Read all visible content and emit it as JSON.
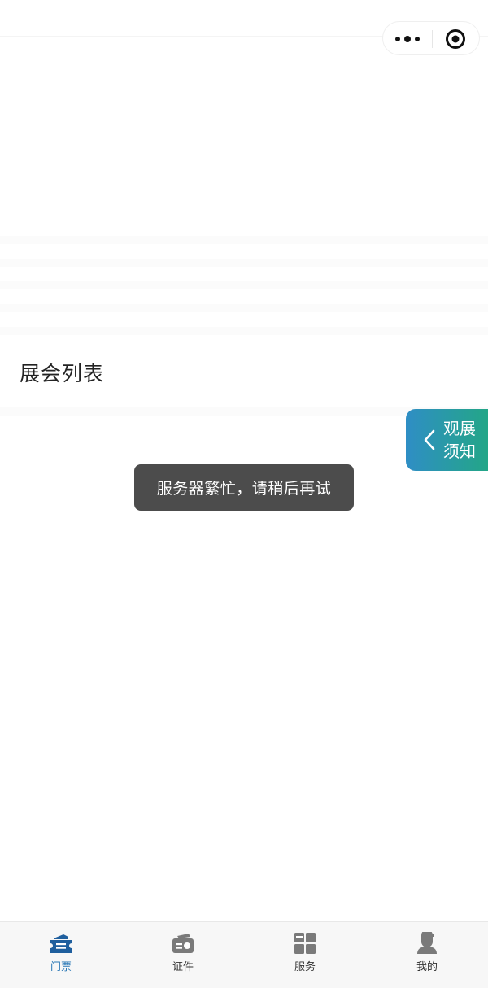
{
  "page": {
    "section_title": "展会列表"
  },
  "capsule": {
    "more_icon": "more-dots-icon",
    "close_icon": "target-circle-icon"
  },
  "notice_tab": {
    "line1": "观展",
    "line2": "须知",
    "icon": "chevron-left-icon",
    "gradient_start": "#2f8ec5",
    "gradient_end": "#23a687"
  },
  "toast": {
    "message": "服务器繁忙，请稍后再试",
    "bg": "#4c4c4c"
  },
  "tabbar": {
    "active_color": "#2a78b6",
    "items": [
      {
        "label": "门票",
        "icon": "ticket-icon",
        "active": true
      },
      {
        "label": "证件",
        "icon": "id-card-icon",
        "active": false
      },
      {
        "label": "服务",
        "icon": "grid-services-icon",
        "active": false
      },
      {
        "label": "我的",
        "icon": "user-profile-icon",
        "active": false
      }
    ]
  }
}
